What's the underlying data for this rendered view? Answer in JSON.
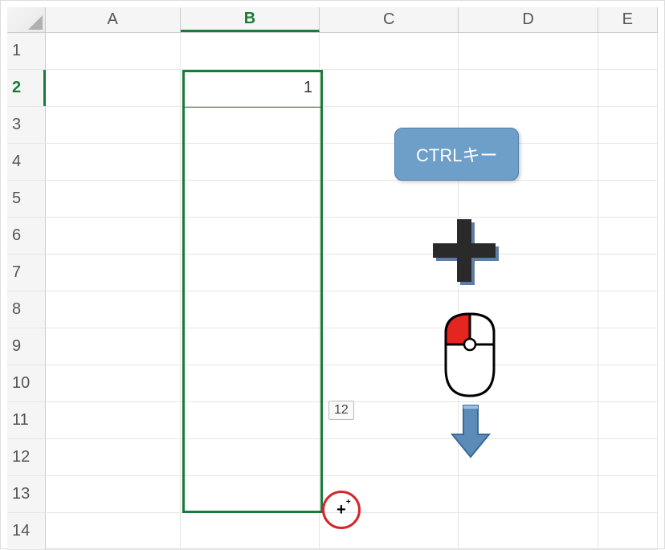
{
  "columns": [
    "A",
    "B",
    "C",
    "D",
    "E"
  ],
  "rows": [
    "1",
    "2",
    "3",
    "4",
    "5",
    "6",
    "7",
    "8",
    "9",
    "10",
    "11",
    "12",
    "13",
    "14"
  ],
  "activeColumn": "B",
  "activeRow": "2",
  "cellValue": "1",
  "tooltipValue": "12",
  "ctrlLabel": "CTRLキー",
  "fillCursor": "+"
}
